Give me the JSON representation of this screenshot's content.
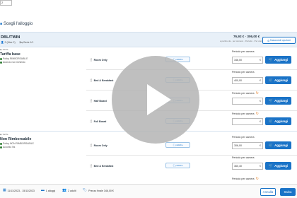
{
  "top": {
    "input_value": "2"
  },
  "section": {
    "title": "Scegli l'alloggio"
  },
  "room": {
    "name": "DBL/TWIN",
    "meta_capacity": "2 (Max 2)",
    "meta_bed": "Beds 1/1",
    "price_total": "76,92 € · 306,00 €",
    "price_sub": "a partire da · per camera · Periodo · Per camera · Per camera",
    "add_option_label": "Nascondi opzioni"
  },
  "rates": [
    {
      "tag": "Tariffa",
      "name": "Tariffa base",
      "line1": "Policy RIMBORSABILE",
      "line2": "Arancio non richiesto",
      "boards": [
        {
          "meal": "Room Only",
          "policy": "politiche",
          "period_label": "Periodo per camera",
          "price": "346,00",
          "refresh": false,
          "add": "Aggiungi"
        },
        {
          "meal": "Bed & Breakfast",
          "policy": "politiche",
          "period_label": "Periodo per camera",
          "price": "400,00",
          "refresh": false,
          "add": "Aggiungi"
        },
        {
          "meal": "Half Board",
          "policy": "politiche",
          "period_label": "Periodo per camera",
          "price": "",
          "refresh": true,
          "add": "Aggiungi"
        },
        {
          "meal": "Full Board",
          "policy": "politiche",
          "period_label": "Periodo per camera",
          "price": "",
          "refresh": true,
          "add": "Aggiungi"
        }
      ]
    },
    {
      "tag": "Tariffa",
      "name": "Non Rimborsabile",
      "line1": "Policy NON RIMBORSABILE",
      "line2": "Acconto Ns",
      "boards": [
        {
          "meal": "Room Only",
          "policy": "politiche",
          "period_label": "Periodo per camera",
          "price": "306,00",
          "refresh": false,
          "add": "Aggiungi"
        },
        {
          "meal": "Bed & Breakfast",
          "policy": "politiche",
          "period_label": "Periodo per camera",
          "price": "360,40",
          "refresh": false,
          "add": "Aggiungi"
        },
        {
          "meal": "Half Board",
          "policy": "politiche",
          "period_label": "Periodo per camera",
          "price": "",
          "refresh": true,
          "add": "Aggiungi"
        }
      ]
    }
  ],
  "currency": "€",
  "footer": {
    "dates": "11/11/2023 - 15/11/2023",
    "rooms": "1 alloggi",
    "guests": "2 adulti",
    "price": "Prezzo finale 346,00 €",
    "cancel_label": "Annulla",
    "save_label": "Salva"
  },
  "colors": {
    "accent": "#1a73c7",
    "header_bg": "#e8f0f8",
    "refresh": "#e67e22"
  },
  "icons": {
    "section": "chevron-icon",
    "meal": "fork-knife-icon",
    "add": "cart-icon",
    "refresh": "refresh-icon",
    "play": "play-icon"
  }
}
